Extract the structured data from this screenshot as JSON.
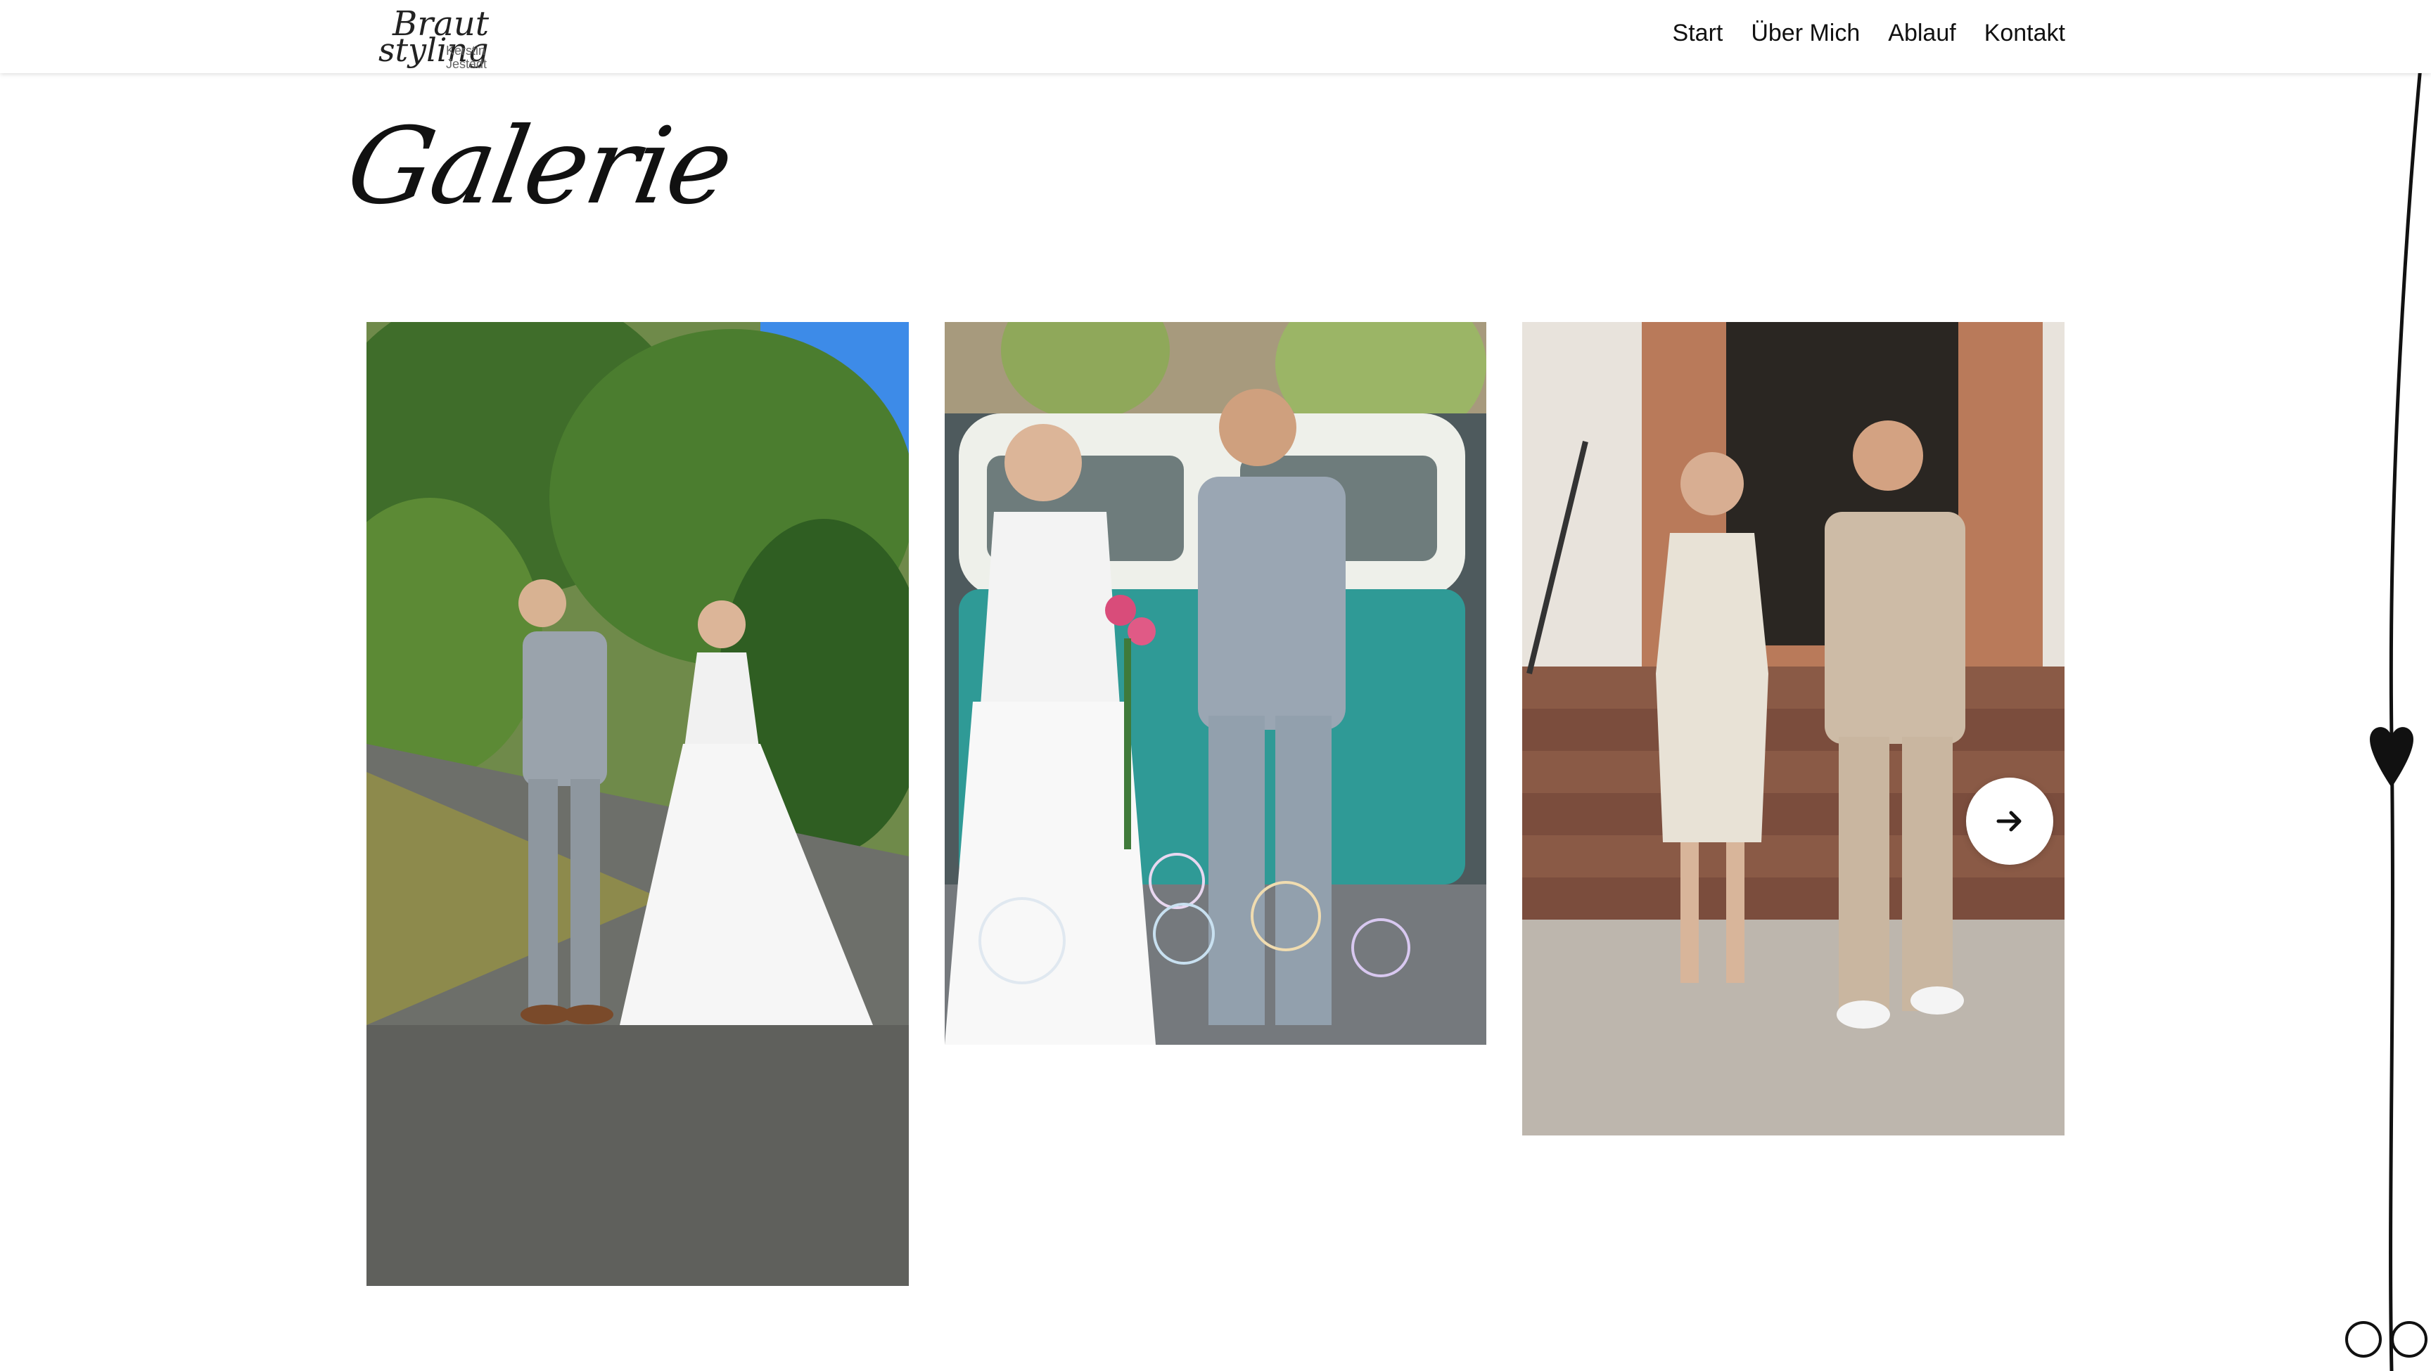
{
  "header": {
    "logo": {
      "line1": "Braut",
      "line2": "styling",
      "name_first": "Kerstin",
      "name_last": "Jestädt"
    },
    "nav": [
      {
        "label": "Start"
      },
      {
        "label": "Über Mich"
      },
      {
        "label": "Ablauf"
      },
      {
        "label": "Kontakt"
      }
    ]
  },
  "main": {
    "title": "Galerie",
    "gallery": {
      "images": [
        {
          "icon": "photo-couple-in-park"
        },
        {
          "icon": "photo-couple-with-vw-bus"
        },
        {
          "icon": "photo-couple-on-steps"
        }
      ],
      "next_icon": "arrow-right-icon"
    }
  },
  "colors": {
    "background": "#ffffff",
    "text": "#111111",
    "accent": "#000000"
  }
}
